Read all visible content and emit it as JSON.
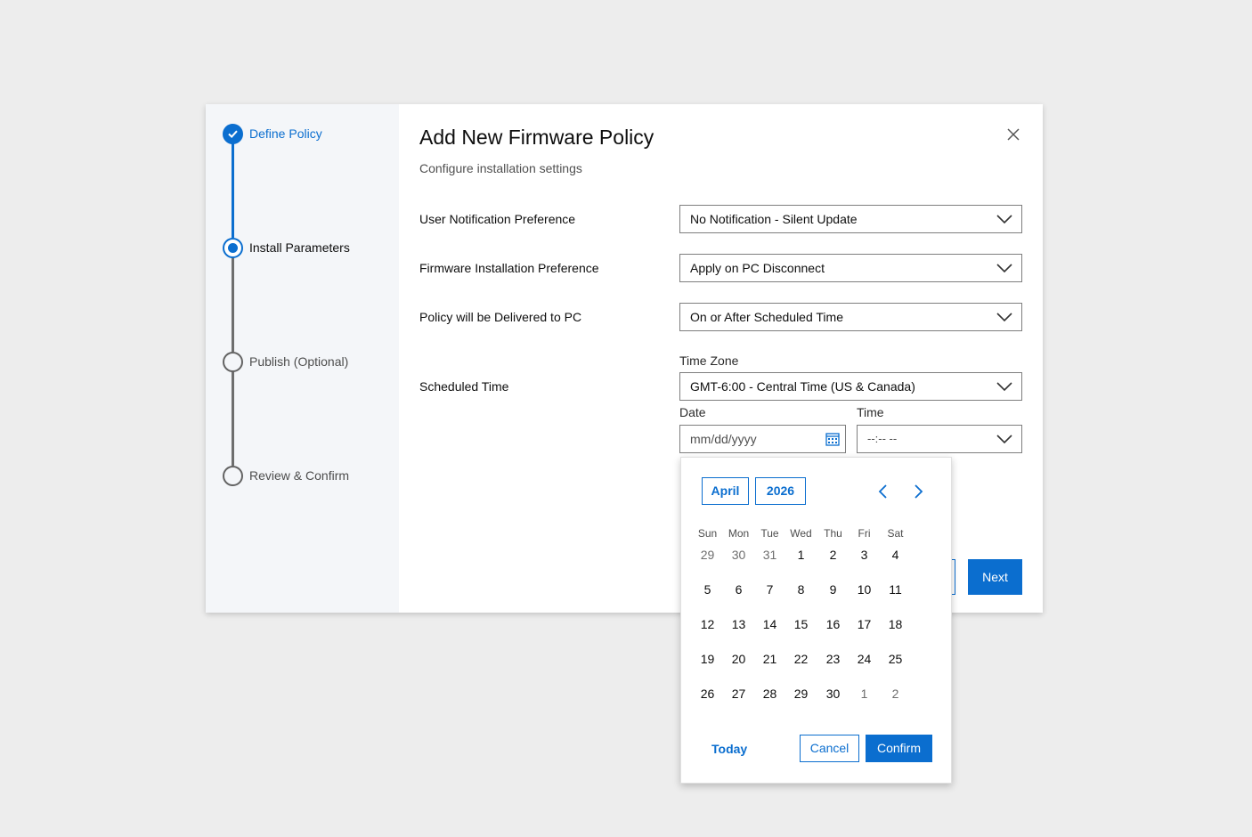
{
  "stepper": {
    "steps": [
      {
        "label": "Define Policy",
        "state": "done"
      },
      {
        "label": "Install Parameters",
        "state": "current"
      },
      {
        "label": "Publish (Optional)",
        "state": "todo"
      },
      {
        "label": "Review & Confirm",
        "state": "todo"
      }
    ]
  },
  "dialog": {
    "title": "Add New Firmware Policy",
    "subtitle": "Configure installation settings",
    "next_label": "Next"
  },
  "form": {
    "notification": {
      "label": "User Notification Preference",
      "value": "No Notification - Silent Update"
    },
    "installation": {
      "label": "Firmware Installation Preference",
      "value": "Apply on PC Disconnect"
    },
    "delivery": {
      "label": "Policy will be Delivered to PC",
      "value": "On or After Scheduled Time"
    },
    "scheduled": {
      "label": "Scheduled Time",
      "timezone_label": "Time Zone",
      "timezone_value": "GMT-6:00 - Central Time (US & Canada)",
      "date_label": "Date",
      "date_placeholder": "mm/dd/yyyy",
      "time_label": "Time",
      "time_placeholder": "--:-- --"
    }
  },
  "calendar": {
    "month": "April",
    "year": "2026",
    "weekdays": [
      "Sun",
      "Mon",
      "Tue",
      "Wed",
      "Thu",
      "Fri",
      "Sat"
    ],
    "weeks": [
      [
        "29",
        "30",
        "31",
        "1",
        "2",
        "3",
        "4"
      ],
      [
        "5",
        "6",
        "7",
        "8",
        "9",
        "10",
        "11"
      ],
      [
        "12",
        "13",
        "14",
        "15",
        "16",
        "17",
        "18"
      ],
      [
        "19",
        "20",
        "21",
        "22",
        "23",
        "24",
        "25"
      ],
      [
        "26",
        "27",
        "28",
        "29",
        "30",
        "1",
        "2"
      ]
    ],
    "outside_month": [
      [
        true,
        true,
        true,
        false,
        false,
        false,
        false
      ],
      [
        false,
        false,
        false,
        false,
        false,
        false,
        false
      ],
      [
        false,
        false,
        false,
        false,
        false,
        false,
        false
      ],
      [
        false,
        false,
        false,
        false,
        false,
        false,
        false
      ],
      [
        false,
        false,
        false,
        false,
        false,
        true,
        true
      ]
    ],
    "today_label": "Today",
    "cancel_label": "Cancel",
    "confirm_label": "Confirm"
  },
  "colors": {
    "accent": "#0b6ecf",
    "stepper_bg": "#f4f6f9",
    "page_bg": "#ededed"
  },
  "icons": [
    "check-icon",
    "close-icon",
    "chevron-down-icon",
    "calendar-icon",
    "chevron-left-icon",
    "chevron-right-icon"
  ]
}
